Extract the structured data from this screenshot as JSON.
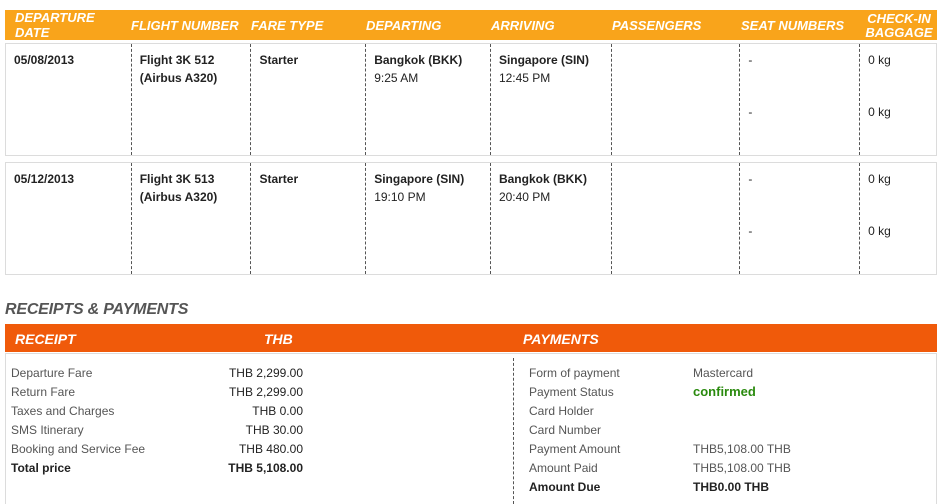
{
  "flight_table": {
    "headers": {
      "departure_date": "DEPARTURE DATE",
      "flight_number": "FLIGHT NUMBER",
      "fare_type": "FARE TYPE",
      "departing": "DEPARTING",
      "arriving": "ARRIVING",
      "passengers": "PASSENGERS",
      "seat_numbers": "SEAT NUMBERS",
      "checkin_baggage_1": "CHECK-IN",
      "checkin_baggage_2": "BAGGAGE"
    },
    "rows": [
      {
        "date": "05/08/2013",
        "flight": "Flight 3K  512",
        "aircraft": "(Airbus A320)",
        "fare": "Starter",
        "dep_city": "Bangkok (BKK)",
        "dep_time": "9:25 AM",
        "arr_city": "Singapore (SIN)",
        "arr_time": "12:45 PM",
        "seat_1": "-",
        "seat_2": "-",
        "bag_1": "0 kg",
        "bag_2": "0 kg"
      },
      {
        "date": "05/12/2013",
        "flight": "Flight 3K  513",
        "aircraft": "(Airbus A320)",
        "fare": "Starter",
        "dep_city": "Singapore (SIN)",
        "dep_time": "19:10 PM",
        "arr_city": "Bangkok (BKK)",
        "arr_time": "20:40 PM",
        "seat_1": "-",
        "seat_2": "-",
        "bag_1": "0 kg",
        "bag_2": "0 kg"
      }
    ]
  },
  "receipts": {
    "section_title": "RECEIPTS & PAYMENTS",
    "header_receipt": "RECEIPT",
    "header_currency": "THB",
    "header_payments": "PAYMENTS",
    "items": [
      {
        "label": "Departure Fare",
        "value": "THB 2,299.00"
      },
      {
        "label": "Return Fare",
        "value": "THB 2,299.00"
      },
      {
        "label": "Taxes and Charges",
        "value": "THB 0.00"
      },
      {
        "label": "SMS Itinerary",
        "value": "THB 30.00"
      },
      {
        "label": "Booking and Service Fee",
        "value": "THB 480.00"
      },
      {
        "label": "Total price",
        "value": "THB 5,108.00"
      }
    ],
    "payments": {
      "form_label": "Form of payment",
      "form_value": "Mastercard",
      "status_label": "Payment Status",
      "status_value": "confirmed",
      "holder_label": "Card Holder",
      "number_label": "Card Number",
      "amount_label": "Payment Amount",
      "amount_value": "THB5,108.00  THB",
      "paid_label": "Amount Paid",
      "paid_value": "THB5,108.00  THB",
      "due_label": "Amount Due",
      "due_value": "THB0.00  THB"
    }
  }
}
